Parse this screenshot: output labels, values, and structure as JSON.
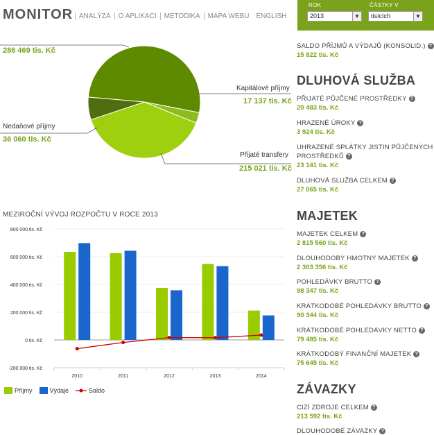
{
  "header": {
    "logo": "MONITOR",
    "nav": [
      "ANALÝZA",
      "O APLIKACI",
      "METODIKA",
      "MAPA WEBU",
      "ENGLISH"
    ],
    "year_label": "ROK",
    "year_value": "2013",
    "amount_label": "ČÁSTKY V",
    "amount_value": "tisících",
    "accent_color": "#7aa21a"
  },
  "pie": {
    "slices": [
      {
        "label": "",
        "value_text": "286 469 tis. Kč",
        "value": 286469,
        "color": "#5e8a00"
      },
      {
        "label": "Kapitálové příjmy",
        "value_text": "17 137 tis. Kč",
        "value": 17137,
        "color": "#8dba1f"
      },
      {
        "label": "Přijaté transfery",
        "value_text": "215 021 tis. Kč",
        "value": 215021,
        "color": "#9fd010"
      },
      {
        "label": "Nedaňové příjmy",
        "value_text": "36 060 tis. Kč",
        "value": 36060,
        "color": "#4e6e10"
      }
    ]
  },
  "chart_title": "MEZIROČNÍ VÝVOJ ROZPOČTU V ROCE 2013",
  "chart_data": {
    "type": "bar",
    "categories": [
      "2010",
      "2011",
      "2012",
      "2013",
      "2014"
    ],
    "series": [
      {
        "name": "Příjmy",
        "values": [
          635000,
          625000,
          375000,
          548000,
          212000
        ],
        "color": "#99cc00"
      },
      {
        "name": "Výdaje",
        "values": [
          698000,
          643000,
          358000,
          532000,
          177000
        ],
        "color": "#1a66cc"
      },
      {
        "name": "Saldo",
        "values": [
          -63000,
          -18000,
          17000,
          16000,
          35000
        ],
        "color": "#cc0000"
      }
    ],
    "ylim": [
      -200000,
      800000
    ],
    "yticks": [
      "800 000 tis. Kč",
      "600 000 tis. Kč",
      "400 000 tis. Kč",
      "200 000 tis. Kč",
      "0 tis. Kč",
      "-200 000 tis. Kč"
    ],
    "legend": "bottom-left"
  },
  "right": {
    "top_item": {
      "label": "SALDO PŘÍJMŮ A VÝDAJŮ (KONSOLID.)",
      "value": "15 822 tis. Kč"
    },
    "sections": [
      {
        "title": "DLUHOVÁ SLUŽBA",
        "items": [
          {
            "label": "PŘIJATÉ PŮJČENÉ PROSTŘEDKY",
            "value": "20 483 tis. Kč"
          },
          {
            "label": "HRAZENÉ ÚROKY",
            "value": "3 924 tis. Kč"
          },
          {
            "label": "UHRAZENÉ SPLÁTKY JISTIN PŮJČENÝCH",
            "label2": "PROSTŘEDKŮ",
            "value": "23 141 tis. Kč"
          },
          {
            "label": "DLUHOVÁ SLUŽBA CELKEM",
            "value": "27 065 tis. Kč"
          }
        ]
      },
      {
        "title": "MAJETEK",
        "items": [
          {
            "label": "MAJETEK CELKEM",
            "value": "2 815 560 tis. Kč"
          },
          {
            "label": "DLOUHODOBÝ HMOTNÝ MAJETEK",
            "value": "2 303 356 tis. Kč"
          },
          {
            "label": "POHLEDÁVKY BRUTTO",
            "value": "98 347 tis. Kč"
          },
          {
            "label": "KRÁTKODOBÉ POHLEDÁVKY BRUTTO",
            "value": "90 344 tis. Kč"
          },
          {
            "label": "KRÁTKODOBÉ POHLEDÁVKY NETTO",
            "value": "79 485 tis. Kč"
          },
          {
            "label": "KRÁTKODOBÝ FINANČNÍ MAJETEK",
            "value": "75 645 tis. Kč"
          }
        ]
      },
      {
        "title": "ZÁVAZKY",
        "items": [
          {
            "label": "CIZÍ ZDROJE CELKEM",
            "value": "213 592 tis. Kč"
          },
          {
            "label": "DLOUHODOBÉ ZÁVAZKY",
            "value": ""
          }
        ]
      }
    ]
  }
}
